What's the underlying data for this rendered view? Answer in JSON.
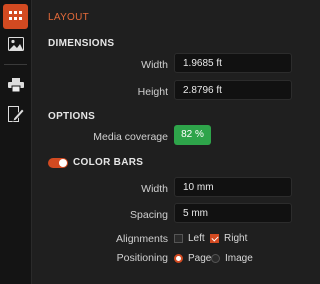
{
  "sidebar": {
    "icons": [
      "grid-icon",
      "image-icon",
      "printer-icon",
      "color-edit-icon"
    ]
  },
  "panel": {
    "header": "LAYOUT",
    "dimensions": {
      "title": "DIMENSIONS",
      "width_label": "Width",
      "width_value": "1.9685 ft",
      "height_label": "Height",
      "height_value": "2.8796 ft"
    },
    "options": {
      "title": "OPTIONS",
      "media_coverage_label": "Media coverage",
      "media_coverage_value": "82 %"
    },
    "color_bars": {
      "title": "COLOR BARS",
      "enabled": true,
      "width_label": "Width",
      "width_value": "10 mm",
      "spacing_label": "Spacing",
      "spacing_value": "5 mm",
      "alignments_label": "Alignments",
      "alignment_left": "Left",
      "alignment_right": "Right",
      "positioning_label": "Positioning",
      "positioning_page": "Page",
      "positioning_image": "Image"
    }
  },
  "colors": {
    "accent": "#d24a21",
    "coverage": "#2ea44a"
  }
}
